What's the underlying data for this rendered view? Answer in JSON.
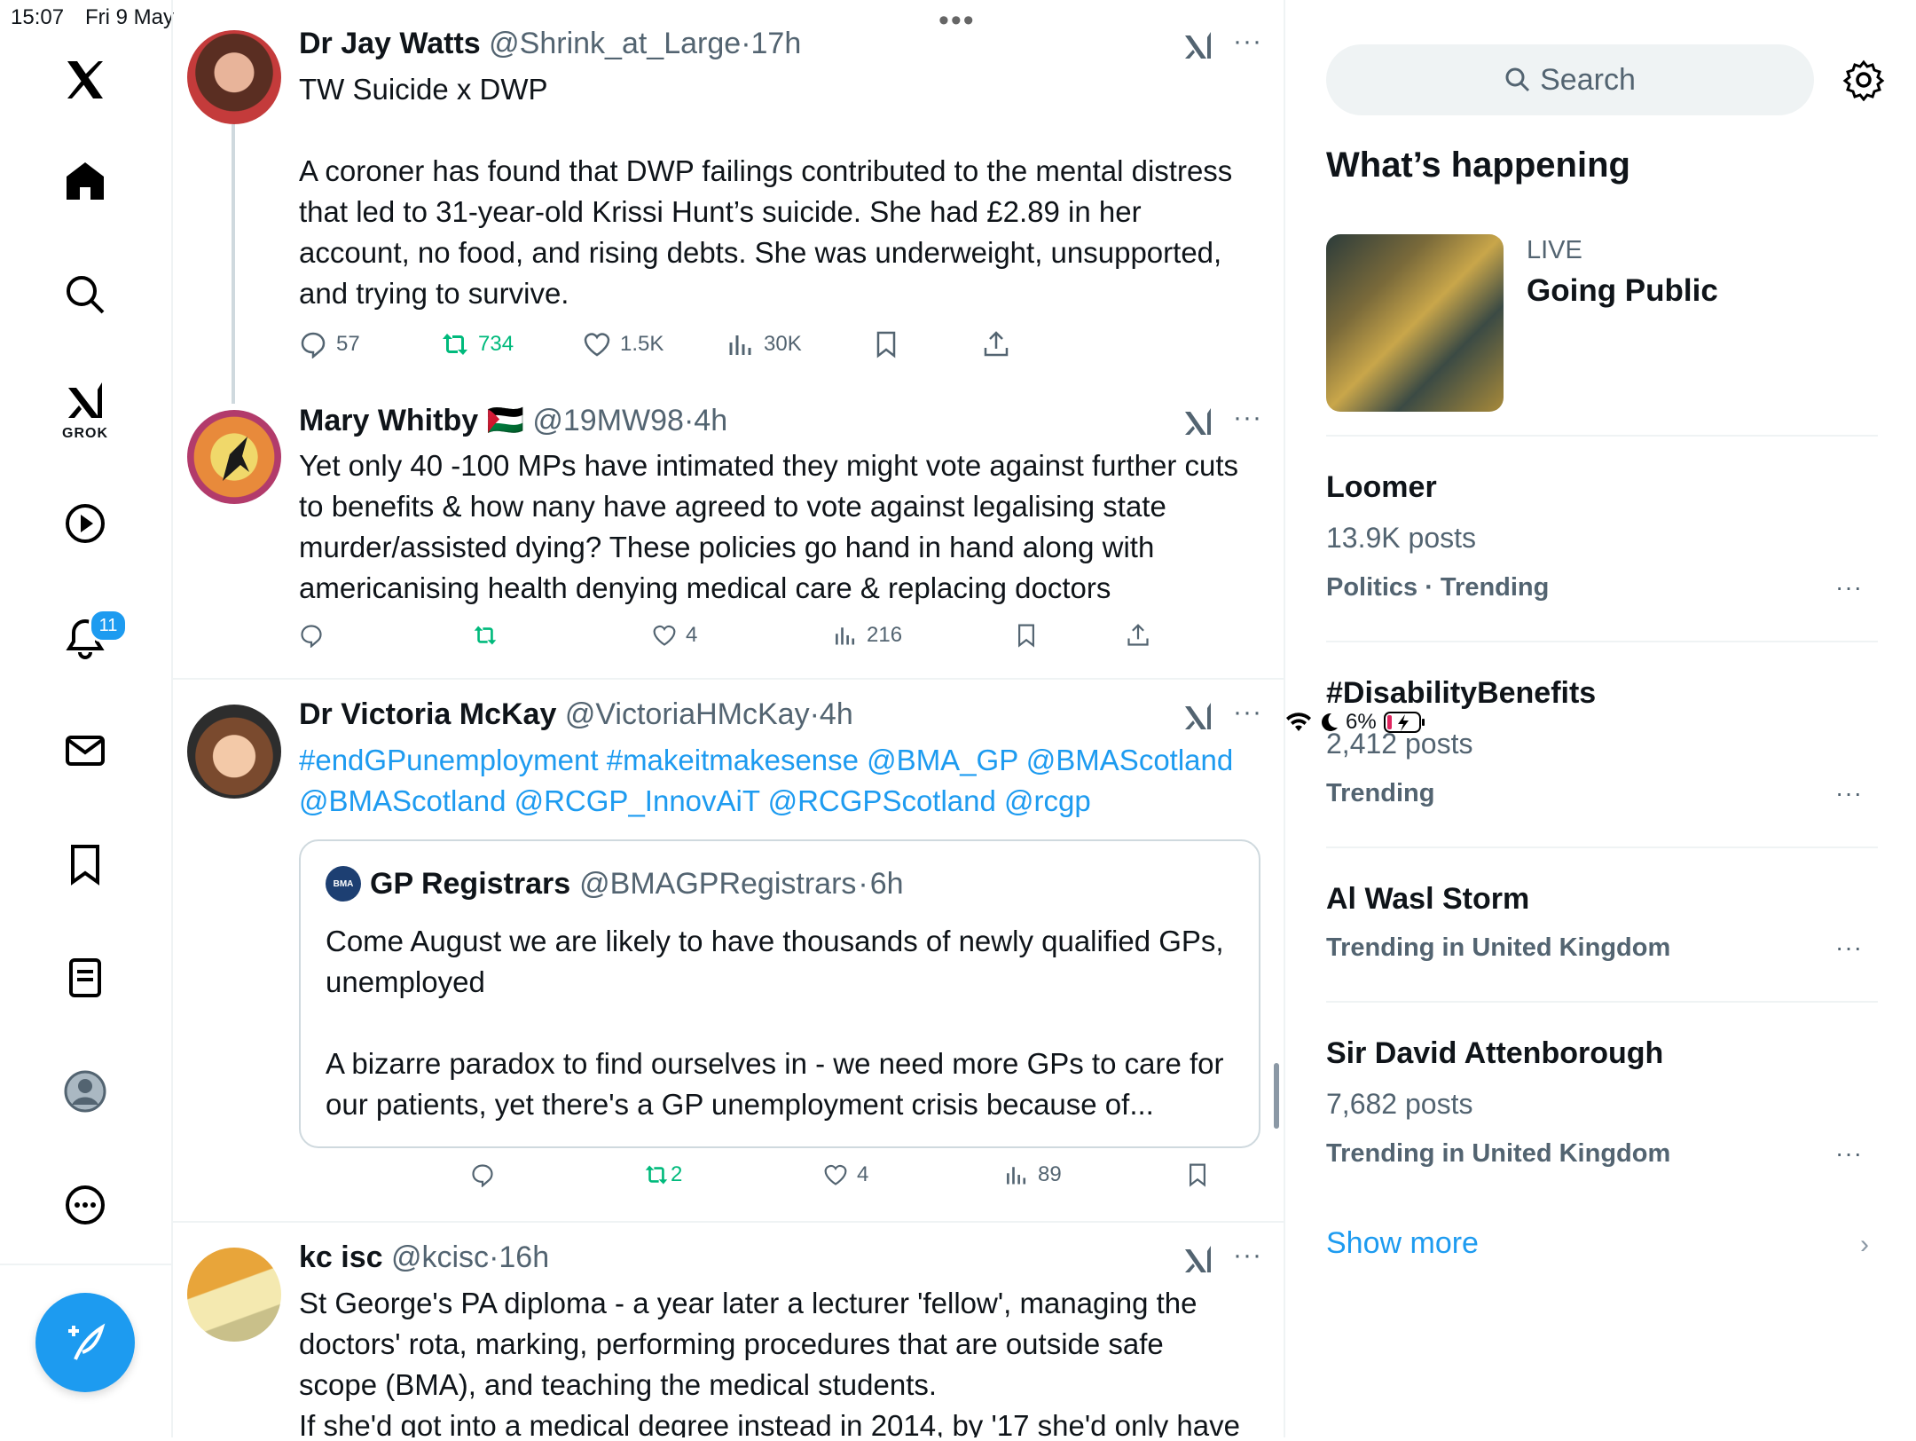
{
  "status_bar": {
    "time": "15:07",
    "date": "Fri 9 May",
    "battery": "6%"
  },
  "nav": {
    "items": [
      "home",
      "explore",
      "grok",
      "video",
      "notifications",
      "messages",
      "bookmarks",
      "lists",
      "profile",
      "more"
    ],
    "grok_label": "GROK",
    "notifications_badge": "11"
  },
  "tweets": [
    {
      "name": "Dr Jay Watts",
      "handle": "@Shrink_at_Large",
      "time": "17h",
      "text": "TW Suicide x DWP\n\n A coroner has found that DWP failings contributed to the mental distress that led to 31-year-old Krissi Hunt’s suicide. She had £2.89 in her account, no food, and rising debts. She was underweight, unsupported, and trying to survive.",
      "replies": "57",
      "reposts": "734",
      "likes": "1.5K",
      "views": "30K"
    },
    {
      "name": "Mary Whitby",
      "flag": "🇵🇸",
      "handle": "@19MW98",
      "time": "4h",
      "text": "Yet only 40 -100 MPs have intimated they might vote against further cuts to benefits & how nany have agreed to vote against legalising state murder/assisted dying? These policies go hand in hand along with americanising health denying medical care & replacing doctors",
      "replies": "",
      "reposts": "",
      "likes": "4",
      "views": "216"
    },
    {
      "name": "Dr Victoria McKay",
      "handle": "@VictoriaHMcKay",
      "time": "4h",
      "text_line1": "#endGPunemployment #makeitmakesense @BMA_GP @BMAScotland",
      "text_line2": "@BMAScotland @RCGP_InnovAiT @RCGPScotland @rcgp",
      "quote": {
        "logo": "BMA",
        "name": "GP Registrars",
        "handle": "@BMAGPRegistrars",
        "time": "6h",
        "text": "Come August we are likely to have thousands of newly qualified GPs, unemployed\n\nA bizarre paradox to find ourselves in - we need more GPs to care for our patients, yet there's a GP unemployment crisis because of..."
      },
      "replies": "",
      "reposts": "2",
      "likes": "4",
      "views": "89"
    },
    {
      "name": "kc isc",
      "handle": "@kcisc",
      "time": "16h",
      "text": "St George's PA diploma -  a year later a lecturer 'fellow', managing the doctors' rota, marking, performing procedures that are outside safe scope (BMA), and teaching the medical students.\nIf she'd got into a medical degree instead in 2014, by '17 she'd only have"
    }
  ],
  "sidebar": {
    "search_placeholder": "Search",
    "heading": "What’s happening",
    "live": {
      "label": "LIVE",
      "title": "Going Public"
    },
    "trends": [
      {
        "title": "Loomer",
        "count": "13.9K posts",
        "context": "Politics · Trending"
      },
      {
        "title": "#DisabilityBenefits",
        "count": "2,412 posts",
        "context": "Trending"
      },
      {
        "title": "Al Wasl Storm",
        "count": "",
        "context": "Trending in United Kingdom"
      },
      {
        "title": "Sir David Attenborough",
        "count": "7,682 posts",
        "context": "Trending in United Kingdom"
      }
    ],
    "show_more": "Show more"
  },
  "colors": {
    "accent": "#1d9bf0",
    "repost": "#00ba7c",
    "secondary_text": "#536471",
    "border": "#eff3f4"
  }
}
